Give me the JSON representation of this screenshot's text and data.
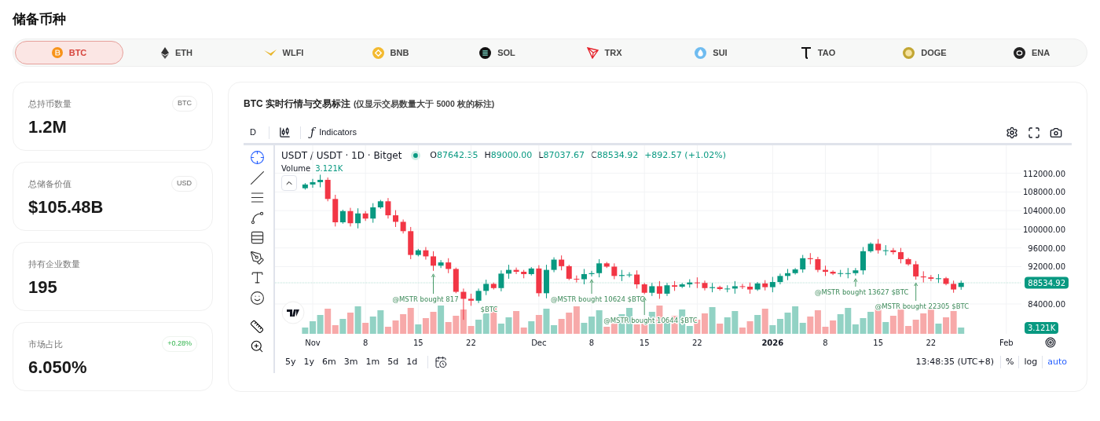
{
  "page_title": "储备币种",
  "coin_tabs": [
    {
      "label": "BTC",
      "selected": true
    },
    {
      "label": "ETH",
      "selected": false
    },
    {
      "label": "WLFI",
      "selected": false
    },
    {
      "label": "BNB",
      "selected": false
    },
    {
      "label": "SOL",
      "selected": false
    },
    {
      "label": "TRX",
      "selected": false
    },
    {
      "label": "SUI",
      "selected": false
    },
    {
      "label": "TAO",
      "selected": false
    },
    {
      "label": "DOGE",
      "selected": false
    },
    {
      "label": "ENA",
      "selected": false
    }
  ],
  "stat_cards": [
    {
      "label": "总持币数量",
      "value": "1.2M",
      "badge": {
        "text": "BTC",
        "kind": "unit"
      }
    },
    {
      "label": "总储备价值",
      "value": "$105.48B",
      "badge": {
        "text": "USD",
        "kind": "unit"
      }
    },
    {
      "label": "持有企业数量",
      "value": "195"
    },
    {
      "label": "市场占比",
      "value": "6.050%",
      "badge": {
        "text": "+0.28%",
        "kind": "positive"
      }
    }
  ],
  "chart_panel": {
    "title": "BTC 实时行情与交易标注",
    "note": "(仅显示交易数量大于 5000 枚的标注)",
    "toolbar": {
      "interval": "D",
      "function_glyph": "ƒ",
      "indicators": "Indicators"
    },
    "legend": {
      "symbol": "USDT / USDT · 1D · Bitget",
      "ohlc": [
        {
          "key": "O",
          "value": "87642.35"
        },
        {
          "key": "H",
          "value": "89000.00"
        },
        {
          "key": "L",
          "value": "87037.67"
        },
        {
          "key": "C",
          "value": "88534.92"
        }
      ],
      "change": "+892.57 (+1.02%)",
      "volume_label": "Volume",
      "volume_value": "3.121K"
    },
    "chart_data": {
      "type": "candlestick",
      "x": [
        "2025-10-31",
        "2025-11-01",
        "2025-11-02",
        "2025-11-03",
        "2025-11-04",
        "2025-11-05",
        "2025-11-06",
        "2025-11-07",
        "2025-11-08",
        "2025-11-09",
        "2025-11-10",
        "2025-11-11",
        "2025-11-12",
        "2025-11-13",
        "2025-11-14",
        "2025-11-15",
        "2025-11-16",
        "2025-11-17",
        "2025-11-18",
        "2025-11-19",
        "2025-11-20",
        "2025-11-21",
        "2025-11-22",
        "2025-11-23",
        "2025-11-24",
        "2025-11-25",
        "2025-11-26",
        "2025-11-27",
        "2025-11-28",
        "2025-11-29",
        "2025-11-30",
        "2025-12-01",
        "2025-12-02",
        "2025-12-03",
        "2025-12-04",
        "2025-12-05",
        "2025-12-06",
        "2025-12-07",
        "2025-12-08",
        "2025-12-09",
        "2025-12-10",
        "2025-12-11",
        "2025-12-12",
        "2025-12-13",
        "2025-12-14",
        "2025-12-15",
        "2025-12-16",
        "2025-12-17",
        "2025-12-18",
        "2025-12-19",
        "2025-12-20",
        "2025-12-21",
        "2025-12-22",
        "2025-12-23",
        "2025-12-24",
        "2025-12-25",
        "2025-12-26",
        "2025-12-27",
        "2025-12-28",
        "2025-12-29",
        "2025-12-30",
        "2025-12-31",
        "2026-01-01",
        "2026-01-02",
        "2026-01-03",
        "2026-01-04",
        "2026-01-05",
        "2026-01-06",
        "2026-01-07",
        "2026-01-08",
        "2026-01-09",
        "2026-01-10",
        "2026-01-11",
        "2026-01-12",
        "2026-01-13",
        "2026-01-14",
        "2026-01-15",
        "2026-01-16",
        "2026-01-17",
        "2026-01-18",
        "2026-01-19",
        "2026-01-20",
        "2026-01-21",
        "2026-01-22",
        "2026-01-23",
        "2026-01-24",
        "2026-01-25",
        "2026-01-26"
      ],
      "ohlc": [
        [
          108800,
          109900,
          108500,
          109600
        ],
        [
          109600,
          110800,
          108900,
          110100
        ],
        [
          110100,
          111700,
          109000,
          110600
        ],
        [
          110600,
          111100,
          106000,
          106500
        ],
        [
          106500,
          107400,
          100600,
          101500
        ],
        [
          101500,
          104200,
          101200,
          103900
        ],
        [
          103900,
          104600,
          100600,
          101300
        ],
        [
          101300,
          104500,
          100200,
          103400
        ],
        [
          103400,
          103900,
          101800,
          102300
        ],
        [
          102300,
          105600,
          101400,
          104700
        ],
        [
          104700,
          106300,
          104400,
          106000
        ],
        [
          106000,
          106700,
          102300,
          103000
        ],
        [
          103000,
          104100,
          100500,
          101600
        ],
        [
          101600,
          102100,
          99100,
          99600
        ],
        [
          99600,
          100500,
          93600,
          94500
        ],
        [
          94500,
          95800,
          94200,
          95500
        ],
        [
          95500,
          96200,
          93500,
          94200
        ],
        [
          94200,
          95300,
          91100,
          92200
        ],
        [
          92200,
          93400,
          91700,
          92900
        ],
        [
          92900,
          93800,
          90600,
          91500
        ],
        [
          91500,
          91800,
          86300,
          86600
        ],
        [
          86600,
          87300,
          80600,
          85100
        ],
        [
          85100,
          86200,
          83600,
          84700
        ],
        [
          84700,
          87300,
          84200,
          86800
        ],
        [
          86800,
          89200,
          85900,
          88300
        ],
        [
          88300,
          88600,
          87100,
          87400
        ],
        [
          87400,
          91200,
          86700,
          90500
        ],
        [
          90500,
          92400,
          89400,
          91300
        ],
        [
          91300,
          91800,
          90400,
          90900
        ],
        [
          90900,
          91300,
          89500,
          90400
        ],
        [
          90400,
          91900,
          90100,
          91600
        ],
        [
          91600,
          92300,
          85600,
          86300
        ],
        [
          86300,
          92400,
          85200,
          91300
        ],
        [
          91300,
          94000,
          90800,
          93500
        ],
        [
          93500,
          94400,
          91200,
          92100
        ],
        [
          92100,
          92400,
          89100,
          89400
        ],
        [
          89400,
          90100,
          88600,
          89300
        ],
        [
          89300,
          91500,
          88200,
          90400
        ],
        [
          90400,
          91100,
          89900,
          90600
        ],
        [
          90600,
          93600,
          89700,
          92700
        ],
        [
          92700,
          93000,
          91700,
          92000
        ],
        [
          92000,
          92700,
          89300,
          90000
        ],
        [
          90000,
          91300,
          88900,
          90200
        ],
        [
          90200,
          90800,
          89700,
          90300
        ],
        [
          90300,
          91200,
          87300,
          88200
        ],
        [
          88200,
          88500,
          86100,
          86400
        ],
        [
          86400,
          88500,
          85700,
          87800
        ],
        [
          87800,
          88900,
          85100,
          86200
        ],
        [
          86200,
          88500,
          85700,
          88000
        ],
        [
          88000,
          88900,
          86800,
          87700
        ],
        [
          87700,
          88500,
          87400,
          88200
        ],
        [
          88200,
          89300,
          87500,
          88600
        ],
        [
          88600,
          89700,
          87400,
          88500
        ],
        [
          88500,
          89000,
          86900,
          87400
        ],
        [
          87400,
          88500,
          86500,
          87600
        ],
        [
          87600,
          87900,
          86900,
          87200
        ],
        [
          87200,
          88000,
          86500,
          87300
        ],
        [
          87300,
          88900,
          86200,
          87800
        ],
        [
          87800,
          88300,
          87200,
          87700
        ],
        [
          87700,
          88600,
          86200,
          87100
        ],
        [
          87100,
          88700,
          86800,
          88400
        ],
        [
          88400,
          89100,
          86900,
          87600
        ],
        [
          87600,
          89800,
          86500,
          88700
        ],
        [
          88700,
          90500,
          88200,
          90000
        ],
        [
          90000,
          91500,
          89100,
          90600
        ],
        [
          90600,
          91700,
          90300,
          91400
        ],
        [
          91400,
          94500,
          90700,
          93800
        ],
        [
          93800,
          94900,
          92500,
          93600
        ],
        [
          93600,
          94100,
          90800,
          91300
        ],
        [
          91300,
          92200,
          90000,
          90900
        ],
        [
          90900,
          91200,
          90200,
          90500
        ],
        [
          90500,
          91300,
          89800,
          90600
        ],
        [
          90600,
          91700,
          89500,
          90600
        ],
        [
          90600,
          91700,
          90100,
          91200
        ],
        [
          91200,
          96200,
          90300,
          95300
        ],
        [
          95300,
          97200,
          95000,
          96900
        ],
        [
          96900,
          97900,
          94800,
          95500
        ],
        [
          95500,
          96600,
          94400,
          95500
        ],
        [
          95500,
          96000,
          94600,
          95100
        ],
        [
          95100,
          96000,
          92700,
          93600
        ],
        [
          93600,
          93900,
          92200,
          92500
        ],
        [
          92500,
          93200,
          89200,
          89900
        ],
        [
          89900,
          91000,
          88600,
          89700
        ],
        [
          89700,
          90200,
          88900,
          89400
        ],
        [
          89400,
          90400,
          88500,
          89500
        ],
        [
          89500,
          89800,
          88000,
          88300
        ],
        [
          88300,
          89000,
          86400,
          87100
        ],
        [
          87642,
          89000,
          87038,
          88535
        ]
      ],
      "xlim": [
        "2025-10-27",
        "2026-02-03"
      ],
      "ylim": [
        77600,
        118000
      ],
      "grid": true,
      "ref_lines": [
        {
          "axis": "y",
          "value": 88534.92,
          "label": "88534.92"
        }
      ],
      "yticks": [
        {
          "value": 112000,
          "label": "112000.00"
        },
        {
          "value": 108000,
          "label": "108000.00"
        },
        {
          "value": 104000,
          "label": "104000.00"
        },
        {
          "value": 100000,
          "label": "100000.00"
        },
        {
          "value": 96000,
          "label": "96000.00"
        },
        {
          "value": 92000,
          "label": "92000.00"
        },
        {
          "value": 84000,
          "label": "84000.00"
        }
      ],
      "xticks": [
        {
          "value": "2025-11-01",
          "label": "Nov"
        },
        {
          "value": "2025-11-08",
          "label": "8"
        },
        {
          "value": "2025-11-15",
          "label": "15"
        },
        {
          "value": "2025-11-22",
          "label": "22"
        },
        {
          "value": "2025-12-01",
          "label": "Dec"
        },
        {
          "value": "2025-12-08",
          "label": "8"
        },
        {
          "value": "2025-12-15",
          "label": "15"
        },
        {
          "value": "2025-12-22",
          "label": "22"
        },
        {
          "value": "2026-01-01",
          "label": "2026"
        },
        {
          "value": "2026-01-08",
          "label": "8"
        },
        {
          "value": "2026-01-15",
          "label": "15"
        },
        {
          "value": "2026-01-22",
          "label": "22"
        },
        {
          "value": "2026-02-01",
          "label": "Feb"
        }
      ],
      "annotations": [
        "@MSTR bought 817",
        "$BTC",
        "@MSTR bought 10624 $BTC",
        "@MSTR bought 10644 $BTC",
        "@MSTR bought 13627 $BTC",
        "@MSTR bought 22305 $BTC"
      ]
    },
    "time_label_styles": [
      {
        "bold": false
      },
      {
        "bold": false
      },
      {
        "bold": false
      },
      {
        "bold": false
      },
      {
        "bold": false
      },
      {
        "bold": false
      },
      {
        "bold": false
      },
      {
        "bold": false
      },
      {
        "bold": true
      },
      {
        "bold": false
      },
      {
        "bold": false
      },
      {
        "bold": false
      },
      {
        "bold": false
      }
    ],
    "last_volume": "3.121K",
    "ranges": [
      "5y",
      "1y",
      "6m",
      "3m",
      "1m",
      "5d",
      "1d"
    ],
    "clock": "13:48:35 (UTC+8)",
    "scale_options": [
      "%",
      "log",
      "auto"
    ]
  }
}
